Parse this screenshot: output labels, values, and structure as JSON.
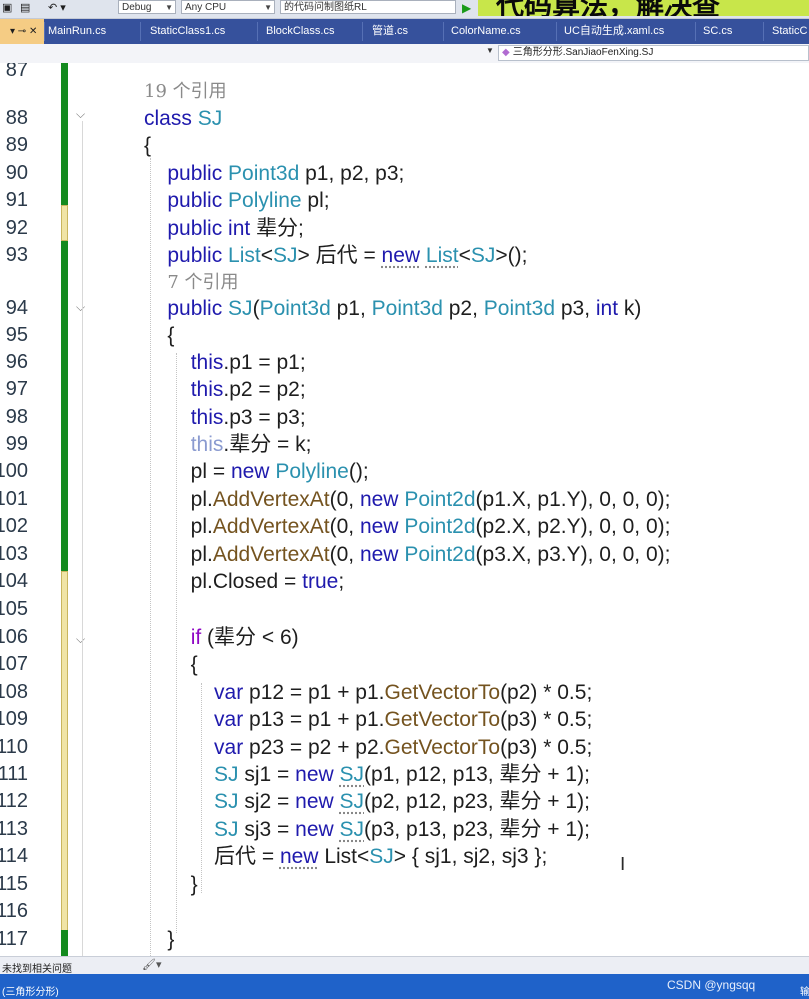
{
  "toolbar": {
    "undo_label": "↶ ▾",
    "config_combo": "Debug",
    "platform_combo": "Any CPU",
    "project_combo": "的代码问制图纸RL",
    "banner_text": "代码算法，解决查"
  },
  "tabs": [
    {
      "label": "",
      "active": true
    },
    {
      "label": "MainRun.cs"
    },
    {
      "label": "StaticClass1.cs"
    },
    {
      "label": "BlockClass.cs"
    },
    {
      "label": "管道.cs"
    },
    {
      "label": "ColorName.cs"
    },
    {
      "label": "UC自动生成.xaml.cs"
    },
    {
      "label": "SC.cs"
    },
    {
      "label": "StaticC"
    }
  ],
  "active_tab_icons": "▾ ⊸ ✕",
  "navigation": {
    "member_combo": "三角形分形.SanJiaoFenXing.SJ"
  },
  "code_lines": [
    {
      "ln": "87",
      "tokens": []
    },
    {
      "ln": "",
      "tokens": [
        {
          "t": "19 个引用",
          "c": "ref"
        }
      ]
    },
    {
      "ln": "88",
      "tokens": [
        {
          "t": "class ",
          "c": "kw"
        },
        {
          "t": "SJ",
          "c": "ty"
        }
      ]
    },
    {
      "ln": "89",
      "tokens": [
        {
          "t": "{"
        }
      ]
    },
    {
      "ln": "90",
      "tokens": [
        {
          "t": "    "
        },
        {
          "t": "public ",
          "c": "kw"
        },
        {
          "t": "Point3d",
          "c": "ty"
        },
        {
          "t": " p1, p2, p3;"
        }
      ]
    },
    {
      "ln": "91",
      "tokens": [
        {
          "t": "    "
        },
        {
          "t": "public ",
          "c": "kw"
        },
        {
          "t": "Polyline",
          "c": "ty"
        },
        {
          "t": " pl;"
        }
      ]
    },
    {
      "ln": "92",
      "tokens": [
        {
          "t": "    "
        },
        {
          "t": "public int ",
          "c": "kw"
        },
        {
          "t": "辈分;"
        }
      ]
    },
    {
      "ln": "93",
      "tokens": [
        {
          "t": "    "
        },
        {
          "t": "public ",
          "c": "kw"
        },
        {
          "t": "List",
          "c": "ty"
        },
        {
          "t": "<"
        },
        {
          "t": "SJ",
          "c": "ty"
        },
        {
          "t": "> 后代 = "
        },
        {
          "t": "new",
          "c": "kw sq"
        },
        {
          "t": " "
        },
        {
          "t": "List",
          "c": "ty sq"
        },
        {
          "t": "<"
        },
        {
          "t": "SJ",
          "c": "ty"
        },
        {
          "t": ">();"
        }
      ]
    },
    {
      "ln": "",
      "tokens": [
        {
          "t": "    "
        },
        {
          "t": "7 个引用",
          "c": "ref"
        }
      ]
    },
    {
      "ln": "94",
      "tokens": [
        {
          "t": "    "
        },
        {
          "t": "public ",
          "c": "kw"
        },
        {
          "t": "SJ",
          "c": "ty"
        },
        {
          "t": "("
        },
        {
          "t": "Point3d",
          "c": "ty"
        },
        {
          "t": " p1, "
        },
        {
          "t": "Point3d",
          "c": "ty"
        },
        {
          "t": " p2, "
        },
        {
          "t": "Point3d",
          "c": "ty"
        },
        {
          "t": " p3, "
        },
        {
          "t": "int",
          "c": "kw"
        },
        {
          "t": " k)"
        }
      ]
    },
    {
      "ln": "95",
      "tokens": [
        {
          "t": "    {"
        }
      ]
    },
    {
      "ln": "96",
      "tokens": [
        {
          "t": "        "
        },
        {
          "t": "this",
          "c": "kw"
        },
        {
          "t": ".p1 = p1;"
        }
      ]
    },
    {
      "ln": "97",
      "tokens": [
        {
          "t": "        "
        },
        {
          "t": "this",
          "c": "kw"
        },
        {
          "t": ".p2 = p2;"
        }
      ]
    },
    {
      "ln": "98",
      "tokens": [
        {
          "t": "        "
        },
        {
          "t": "this",
          "c": "kw"
        },
        {
          "t": ".p3 = p3;"
        }
      ]
    },
    {
      "ln": "99",
      "tokens": [
        {
          "t": "        "
        },
        {
          "t": "this",
          "c": "dim"
        },
        {
          "t": ".辈分 = k;"
        }
      ]
    },
    {
      "ln": "100",
      "tokens": [
        {
          "t": "        pl = "
        },
        {
          "t": "new ",
          "c": "kw"
        },
        {
          "t": "Polyline",
          "c": "ty"
        },
        {
          "t": "();"
        }
      ]
    },
    {
      "ln": "101",
      "tokens": [
        {
          "t": "        pl."
        },
        {
          "t": "AddVertexAt",
          "c": "me"
        },
        {
          "t": "(0, "
        },
        {
          "t": "new ",
          "c": "kw"
        },
        {
          "t": "Point2d",
          "c": "ty"
        },
        {
          "t": "(p1.X, p1.Y), 0, 0, 0);"
        }
      ]
    },
    {
      "ln": "102",
      "tokens": [
        {
          "t": "        pl."
        },
        {
          "t": "AddVertexAt",
          "c": "me"
        },
        {
          "t": "(0, "
        },
        {
          "t": "new ",
          "c": "kw"
        },
        {
          "t": "Point2d",
          "c": "ty"
        },
        {
          "t": "(p2.X, p2.Y), 0, 0, 0);"
        }
      ]
    },
    {
      "ln": "103",
      "tokens": [
        {
          "t": "        pl."
        },
        {
          "t": "AddVertexAt",
          "c": "me"
        },
        {
          "t": "(0, "
        },
        {
          "t": "new ",
          "c": "kw"
        },
        {
          "t": "Point2d",
          "c": "ty"
        },
        {
          "t": "(p3.X, p3.Y), 0, 0, 0);"
        }
      ]
    },
    {
      "ln": "104",
      "tokens": [
        {
          "t": "        pl.Closed = "
        },
        {
          "t": "true",
          "c": "kw"
        },
        {
          "t": ";"
        }
      ]
    },
    {
      "ln": "105",
      "tokens": []
    },
    {
      "ln": "106",
      "tokens": [
        {
          "t": "        "
        },
        {
          "t": "if",
          "c": "ct"
        },
        {
          "t": " (辈分 < 6)"
        }
      ]
    },
    {
      "ln": "107",
      "tokens": [
        {
          "t": "        {"
        }
      ]
    },
    {
      "ln": "108",
      "tokens": [
        {
          "t": "            "
        },
        {
          "t": "var",
          "c": "kw"
        },
        {
          "t": " p12 = p1 + p1."
        },
        {
          "t": "GetVectorTo",
          "c": "me"
        },
        {
          "t": "(p2) * 0.5;"
        }
      ]
    },
    {
      "ln": "109",
      "tokens": [
        {
          "t": "            "
        },
        {
          "t": "var",
          "c": "kw"
        },
        {
          "t": " p13 = p1 + p1."
        },
        {
          "t": "GetVectorTo",
          "c": "me"
        },
        {
          "t": "(p3) * 0.5;"
        }
      ]
    },
    {
      "ln": "110",
      "tokens": [
        {
          "t": "            "
        },
        {
          "t": "var",
          "c": "kw"
        },
        {
          "t": " p23 = p2 + p2."
        },
        {
          "t": "GetVectorTo",
          "c": "me"
        },
        {
          "t": "(p3) * 0.5;"
        }
      ]
    },
    {
      "ln": "111",
      "tokens": [
        {
          "t": "            "
        },
        {
          "t": "SJ",
          "c": "ty"
        },
        {
          "t": " sj1 = "
        },
        {
          "t": "new ",
          "c": "kw"
        },
        {
          "t": "SJ",
          "c": "ty sq"
        },
        {
          "t": "(p1, p12, p13, 辈分 + 1);"
        }
      ]
    },
    {
      "ln": "112",
      "tokens": [
        {
          "t": "            "
        },
        {
          "t": "SJ",
          "c": "ty"
        },
        {
          "t": " sj2 = "
        },
        {
          "t": "new ",
          "c": "kw"
        },
        {
          "t": "SJ",
          "c": "ty sq"
        },
        {
          "t": "(p2, p12, p23, 辈分 + 1);"
        }
      ]
    },
    {
      "ln": "113",
      "tokens": [
        {
          "t": "            "
        },
        {
          "t": "SJ",
          "c": "ty"
        },
        {
          "t": " sj3 = "
        },
        {
          "t": "new ",
          "c": "kw"
        },
        {
          "t": "SJ",
          "c": "ty sq"
        },
        {
          "t": "(p3, p13, p23, 辈分 + 1);"
        }
      ]
    },
    {
      "ln": "114",
      "tokens": [
        {
          "t": "            后代 = "
        },
        {
          "t": "new",
          "c": "kw sq"
        },
        {
          "t": " List<"
        },
        {
          "t": "SJ",
          "c": "ty"
        },
        {
          "t": "> { sj1, sj2, sj3 };"
        }
      ]
    },
    {
      "ln": "115",
      "tokens": [
        {
          "t": "        }"
        }
      ]
    },
    {
      "ln": "116",
      "tokens": []
    },
    {
      "ln": "117",
      "tokens": [
        {
          "t": "    }"
        }
      ]
    }
  ],
  "status": {
    "issues_text": "未找到相关问题",
    "brush_icon": "brush-icon ▾",
    "bottom_left": "(三角形分形)",
    "watermark": "CSDN @yngsqq",
    "bottom_right": "输"
  },
  "colors": {
    "tab_bar": "#36519c",
    "active_tab": "#f5cc84",
    "keyword": "#1f1aad",
    "type": "#2b91af",
    "method": "#74531f",
    "control": "#8f08c4",
    "change_saved": "#138a1e",
    "change_unsaved": "#f0e4a6",
    "status_bar": "#1f62c9"
  }
}
